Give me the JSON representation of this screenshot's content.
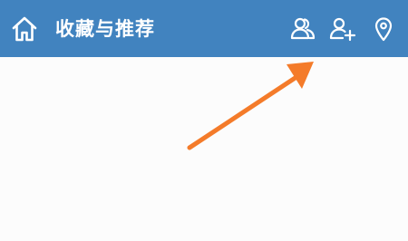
{
  "header": {
    "title": "收藏与推荐",
    "background_color": "#4183bf",
    "text_color": "#ffffff",
    "icons": {
      "home": "home-icon",
      "friends": "friends-icon",
      "add_friend": "add-friend-icon",
      "location": "location-pin-icon"
    }
  },
  "annotation": {
    "arrow_color": "#f47b2a",
    "points_to": "friends-button"
  }
}
